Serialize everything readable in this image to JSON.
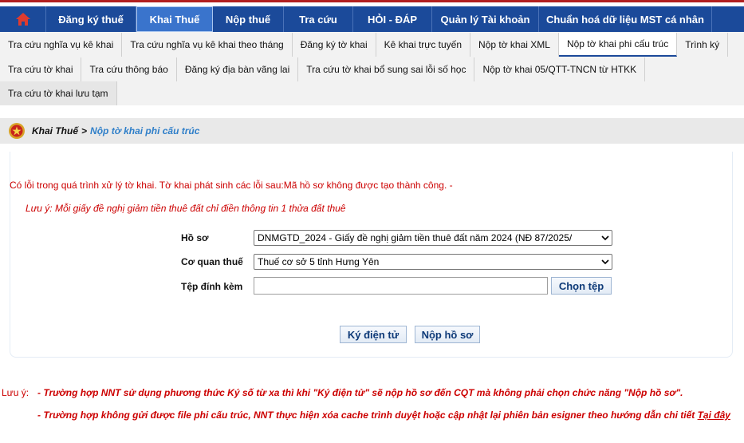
{
  "top_nav": {
    "items": [
      "Đăng ký thuế",
      "Khai Thuế",
      "Nộp thuế",
      "Tra cứu",
      "HỎI - ĐÁP",
      "Quản lý Tài khoản",
      "Chuẩn hoá dữ liệu MST cá nhân"
    ],
    "active": "Khai Thuế"
  },
  "sub_nav": {
    "row1": [
      "Tra cứu nghĩa vụ kê khai",
      "Tra cứu nghĩa vụ kê khai theo tháng",
      "Đăng ký tờ khai",
      "Kê khai trực tuyến",
      "Nộp tờ khai XML",
      "Nộp tờ khai phi cấu trúc",
      "Trình ký"
    ],
    "row2": [
      "Tra cứu tờ khai",
      "Tra cứu thông báo",
      "Đăng ký địa bàn vãng lai",
      "Tra cứu tờ khai bổ sung sai lỗi số học",
      "Nộp tờ khai 05/QTT-TNCN từ HTKK"
    ],
    "row3": [
      "Tra cứu tờ khai lưu tạm"
    ],
    "active": "Nộp tờ khai phi cấu trúc"
  },
  "breadcrumb": {
    "root": "Khai Thuế",
    "separator": ">",
    "current": "Nộp tờ khai phi cấu trúc"
  },
  "messages": {
    "error": "Có lỗi trong quá trình xử lý tờ khai. Tờ khai phát sinh các lỗi sau:Mã hồ sơ không được tạo thành công. -",
    "note": "Lưu ý: Mỗi giấy đề nghị giảm tiền thuê đất chỉ điền thông tin 1 thửa đất thuê"
  },
  "form": {
    "ho_so_label": "Hồ sơ",
    "ho_so_value": "DNMGTD_2024 - Giấy đề nghị giảm tiền thuê đất năm 2024 (NĐ 87/2025/",
    "co_quan_label": "Cơ quan thuế",
    "co_quan_value": "Thuế cơ sở 5 tỉnh Hưng Yên",
    "tep_label": "Tệp đính kèm",
    "choose_file_label": "Chọn tệp",
    "sign_label": "Ký điện tử",
    "submit_label": "Nộp hồ sơ"
  },
  "footer": {
    "label": "Lưu ý:",
    "line1": "- Trường hợp NNT sử dụng phương thức Ký số từ xa thì khi \"Ký điện tử\" sẽ nộp hồ sơ đến CQT mà không phải chọn chức năng \"Nộp hồ sơ\".",
    "line2": "- Trường hợp không gửi được file phi cấu trúc, NNT thực hiện xóa cache trình duyệt hoặc cập nhật lại phiên bản esigner theo hướng dẫn chi tiết",
    "link": "Tại đây"
  },
  "colors": {
    "nav_bg": "#1b4a9a",
    "nav_active": "#3a74cc",
    "error": "#cc0000",
    "breadcrumb_current": "#2f7fc9"
  },
  "icons": {
    "home": "home-icon",
    "emblem": "emblem-icon",
    "dropdown": "chevron-down-icon"
  }
}
